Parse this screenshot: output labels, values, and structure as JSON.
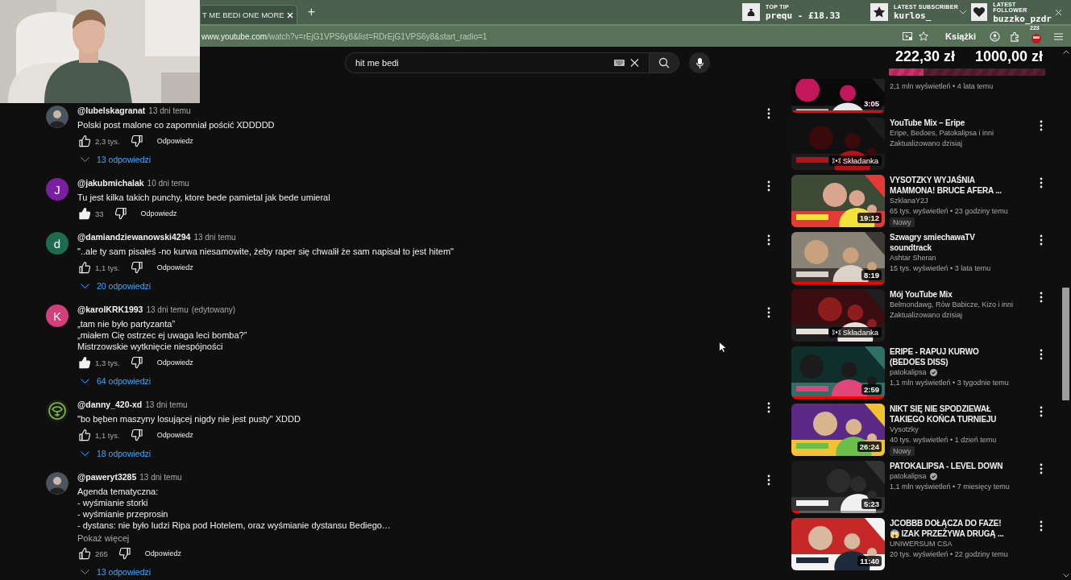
{
  "browser": {
    "tab": {
      "title": "T ME BEDI ONE MORE"
    },
    "new_tab_label": "+",
    "address": {
      "host": "www.youtube.com",
      "path": "/watch?v=rEjG1VPS6y8&list=RDrEjG1VPS6y8&start_radio=1"
    },
    "bookmarks_label": "Książki",
    "extension_badge": "223"
  },
  "stream_overlay": {
    "alerts": [
      {
        "kind": "tip",
        "label": "TOP TIP",
        "value": "prequ - £18.33"
      },
      {
        "kind": "subscriber",
        "label": "LATEST SUBSCRIBER",
        "value": "kurlos_"
      },
      {
        "kind": "follower",
        "label": "LATEST FOLLOWER",
        "value": "buzzko_pzdr"
      }
    ],
    "goal": {
      "raised": "222,30 zł",
      "target": "1000,00 zł",
      "level": 0.22
    }
  },
  "search": {
    "value": "hit me bedi"
  },
  "comments": [
    {
      "author": "@lubelskagranat",
      "time": "13 dni temu",
      "lines": [
        "Polski post malone co zapomniał pościć XDDDDD"
      ],
      "likes": "2,3 tys.",
      "liked": false,
      "reply_label": "Odpowiedz",
      "replies": "13 odpowiedzi"
    },
    {
      "avatar": {
        "kind": "letter",
        "letter": "J",
        "color": "#7b1fa2"
      },
      "author": "@jakubmichalak",
      "time": "10 dni temu",
      "lines": [
        "Tu jest kilka takich punchy, ktore bede pamietal jak bede umieral"
      ],
      "likes": "33",
      "liked": true,
      "reply_label": "Odpowiedz"
    },
    {
      "avatar": {
        "kind": "letter",
        "letter": "d",
        "color": "#1e6b4f"
      },
      "author": "@damiandziewanowski4294",
      "time": "13 dni temu",
      "lines": [
        "\"..ale ty sam pisałeś -no kurwa niesamowite, żeby raper się chwalił że sam napisał to jest hitem\""
      ],
      "likes": "1,1 tys.",
      "liked": false,
      "reply_label": "Odpowiedz",
      "replies": "20 odpowiedzi"
    },
    {
      "avatar": {
        "kind": "letter",
        "letter": "K",
        "color": "#d33f7a"
      },
      "author": "@karolKRK1993",
      "time": "13 dni temu",
      "edited": "(edytowany)",
      "lines": [
        "„tam nie było partyzanta”",
        "„miałem Cię ostrzec ej uwaga leci bomba?”",
        "Mistrzowskie wytknięcie niespójności"
      ],
      "likes": "1,3 tys.",
      "liked": true,
      "reply_label": "Odpowiedz",
      "replies": "64 odpowiedzi"
    },
    {
      "avatar": {
        "kind": "emblem"
      },
      "author": "@danny_420-xd",
      "time": "13 dni temu",
      "lines": [
        "\"bo bęben maszyny losującej nigdy nie jest pusty\" XDDD"
      ],
      "likes": "1,1 tys.",
      "liked": false,
      "reply_label": "Odpowiedz",
      "replies": "18 odpowiedzi"
    },
    {
      "author": "@paweryt3285",
      "time": "13 dni temu",
      "lines": [
        "Agenda tematyczna:",
        "- wyśmianie storki",
        "- wyśmianie przeprosin",
        "- dystans: nie było ludzi Ripa pod Hotelem, oraz wyśmianie dystansu Bediego…"
      ],
      "more": "Pokaż więcej",
      "likes": "265",
      "liked": false,
      "reply_label": "Odpowiedz",
      "replies": "13 odpowiedzi"
    }
  ],
  "sidebar": [
    {
      "kind": "video",
      "meta": "2,1 mln wyświetleń • 4 lata temu",
      "duration": "3:05",
      "level": 1,
      "verified": false
    },
    {
      "kind": "mix",
      "title": "YouTube Mix – Eripe",
      "channel": "Eripe, Bedoes, Patokalipsa i inni",
      "meta": "Zaktualizowano dzisiaj",
      "mix_label": "Składanka",
      "verified": false
    },
    {
      "kind": "video",
      "title": "VYSOTZKY WYJAŚNIA MAMMONA! BRUCE AFERA ...",
      "channel": "SzklanaY2J",
      "meta": "65 tys. wyświetleń • 23 godziny temu",
      "badge": "Nowy",
      "duration": "19:12",
      "verified": false
    },
    {
      "kind": "video",
      "title": "Szwagry smiechawaTV soundtrack",
      "channel": "Ashtar Sheran",
      "meta": "15 tys. wyświetleń • 3 lata temu",
      "duration": "8:19",
      "level": 1,
      "verified": false
    },
    {
      "kind": "mix",
      "title": "Mój YouTube Mix",
      "channel": "Belmondawg, Rów Babicze, Kizo i inni",
      "meta": "Zaktualizowano dzisiaj",
      "mix_label": "Składanka",
      "verified": false
    },
    {
      "kind": "video",
      "title": "ERIPE - RAPUJ KURWO (BEDOES DISS)",
      "channel": "patokalipsa",
      "meta": "1,1 mln wyświetleń • 3 tygodnie temu",
      "duration": "2:59",
      "level": 1,
      "verified": true
    },
    {
      "kind": "video",
      "title": "NIKT SIĘ NIE SPODZIEWAŁ TAKIEGO KOŃCA TURNIEJU",
      "channel": "Vysotzky",
      "meta": "40 tys. wyświetleń • 1 dzień temu",
      "badge": "Nowy",
      "duration": "26:24",
      "verified": false
    },
    {
      "kind": "video",
      "title": "PATOKALIPSA - LEVEL DOWN",
      "channel": "patokalipsa",
      "meta": "1,1 mln wyświetleń • 7 miesięcy temu",
      "duration": "5:23",
      "level": 0.08,
      "verified": true
    },
    {
      "kind": "video",
      "title": "JCOBBB DOŁĄCZA DO FAZE! 😱 IZAK PRZEŻYWA DRUGĄ ...",
      "channel": "UNIWERSUM CSA",
      "meta": "20 tys. wyświetleń • 22 godziny temu",
      "duration": "11:40",
      "verified": false
    }
  ]
}
